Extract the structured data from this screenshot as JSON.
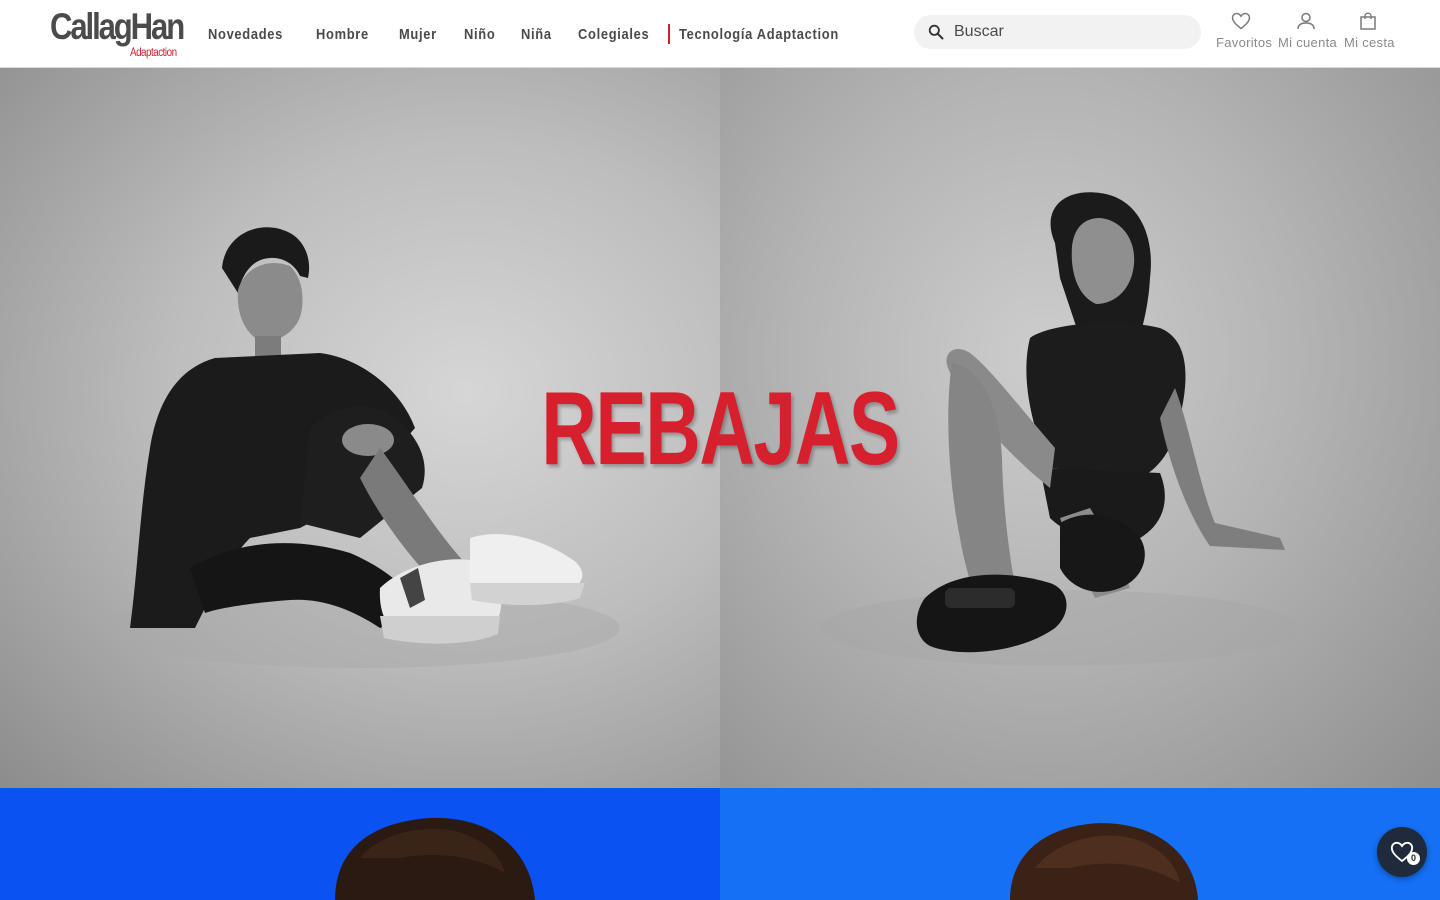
{
  "header": {
    "logo": {
      "main": "CallagHan",
      "sub": "Adaptaction"
    },
    "nav": [
      {
        "label": "Novedades"
      },
      {
        "label": "Hombre"
      },
      {
        "label": "Mujer"
      },
      {
        "label": "Niño"
      },
      {
        "label": "Niña"
      },
      {
        "label": "Colegiales"
      },
      {
        "label": "Tecnología Adaptaction",
        "highlight": true
      }
    ],
    "search": {
      "placeholder": "Buscar",
      "value": "",
      "icon": "search-icon"
    },
    "actions": [
      {
        "label": "Favoritos",
        "icon": "heart-icon"
      },
      {
        "label": "Mi cuenta",
        "icon": "user-icon"
      },
      {
        "label": "Mi cesta",
        "icon": "bag-icon"
      }
    ]
  },
  "hero": {
    "title": "REBAJAS",
    "left_image": "man-sitting-sneakers",
    "right_image": "woman-sitting-sandals"
  },
  "banner2": {
    "left_image": "person-blue-background",
    "right_image": "woman-blue-background"
  },
  "floating_favorites": {
    "count": "0",
    "icon": "heart-icon"
  },
  "colors": {
    "brand_red": "#d7202e",
    "text_gray": "#4a4a4a",
    "blue_left": "#0a52f2",
    "blue_right": "#1570f5",
    "float_bg": "#1f2a3c"
  }
}
